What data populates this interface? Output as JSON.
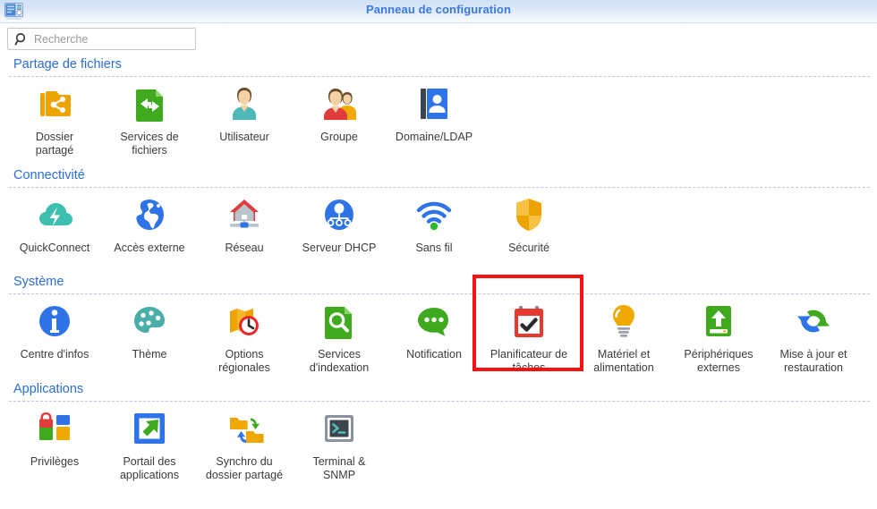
{
  "window": {
    "title": "Panneau de configuration",
    "app_icon": "control-panel-icon",
    "title_color": "#3a78e0"
  },
  "search": {
    "placeholder": "Recherche",
    "value": "",
    "icon": "search-icon"
  },
  "sections": [
    {
      "title": "Partage de fichiers",
      "items": [
        {
          "label": "Dossier\npartagé",
          "icon": "shared-folder-icon",
          "color": "#eda400"
        },
        {
          "label": "Services de\nfichiers",
          "icon": "file-services-icon",
          "color": "#3faa1e"
        },
        {
          "label": "Utilisateur",
          "icon": "user-icon",
          "color": "#5bc3c3"
        },
        {
          "label": "Groupe",
          "icon": "group-icon",
          "color": "#e23b3b"
        },
        {
          "label": "Domaine/LDAP",
          "icon": "domain-ldap-icon",
          "color": "#2f73e8"
        }
      ]
    },
    {
      "title": "Connectivité",
      "items": [
        {
          "label": "QuickConnect",
          "icon": "quickconnect-cloud-icon",
          "color": "#3dbfb0"
        },
        {
          "label": "Accès externe",
          "icon": "globe-icon",
          "color": "#2f73e8"
        },
        {
          "label": "Réseau",
          "icon": "network-house-icon",
          "color": "#e23b3b"
        },
        {
          "label": "Serveur DHCP",
          "icon": "dhcp-server-icon",
          "color": "#2f73e8"
        },
        {
          "label": "Sans fil",
          "icon": "wifi-icon",
          "color": "#2f73e8"
        },
        {
          "label": "Sécurité",
          "icon": "shield-icon",
          "color": "#eda400"
        }
      ]
    },
    {
      "title": "Système",
      "items": [
        {
          "label": "Centre d'infos",
          "icon": "info-circle-icon",
          "color": "#2f73e8"
        },
        {
          "label": "Thème",
          "icon": "palette-icon",
          "color": "#4aada8"
        },
        {
          "label": "Options\nrégionales",
          "icon": "regional-clock-icon",
          "color": "#eda400"
        },
        {
          "label": "Services\nd'indexation",
          "icon": "indexing-icon",
          "color": "#3faa1e"
        },
        {
          "label": "Notification",
          "icon": "notification-icon",
          "color": "#3faa1e"
        },
        {
          "label": "Planificateur de\ntâches",
          "icon": "task-scheduler-icon",
          "color": "#e8392f",
          "highlighted": true
        },
        {
          "label": "Matériel et\nalimentation",
          "icon": "lightbulb-icon",
          "color": "#f0a900"
        },
        {
          "label": "Périphériques\nexternes",
          "icon": "external-device-icon",
          "color": "#3faa1e"
        },
        {
          "label": "Mise à jour et\nrestauration",
          "icon": "update-restore-icon",
          "color": "#3faa1e"
        }
      ]
    },
    {
      "title": "Applications",
      "items": [
        {
          "label": "Privilèges",
          "icon": "privileges-icon",
          "color": "#e23b3b"
        },
        {
          "label": "Portail des\napplications",
          "icon": "app-portal-icon",
          "color": "#2f73e8"
        },
        {
          "label": "Synchro du\ndossier partagé",
          "icon": "folder-sync-icon",
          "color": "#eda400"
        },
        {
          "label": "Terminal &\nSNMP",
          "icon": "terminal-snmp-icon",
          "color": "#4e5a68"
        }
      ]
    }
  ],
  "highlight": {
    "target_label": "Planificateur de tâches",
    "color": "#f91010"
  }
}
